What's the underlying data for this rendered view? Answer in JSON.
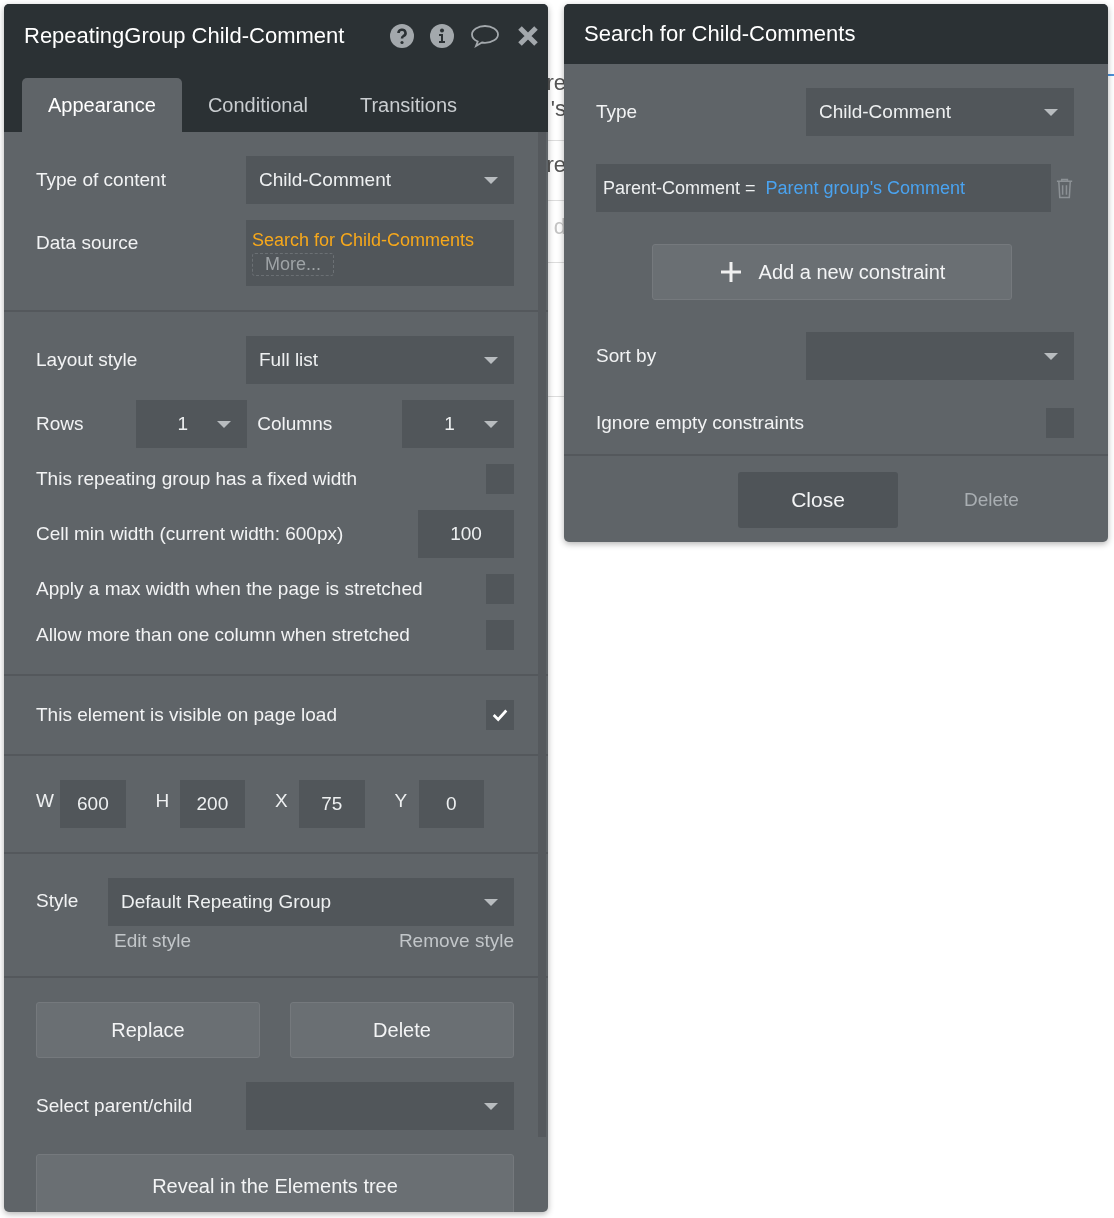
{
  "canvas_fragments": [
    "re",
    "'s",
    "re",
    "d"
  ],
  "properties_panel": {
    "title": "RepeatingGroup Child-Comment",
    "tabs": [
      {
        "label": "Appearance",
        "selected": true
      },
      {
        "label": "Conditional",
        "selected": false
      },
      {
        "label": "Transitions",
        "selected": false
      }
    ],
    "type_of_content": {
      "label": "Type of content",
      "value": "Child-Comment"
    },
    "data_source": {
      "label": "Data source",
      "value": "Search for Child-Comments",
      "more": "More..."
    },
    "layout_style": {
      "label": "Layout style",
      "value": "Full list"
    },
    "rows": {
      "label": "Rows",
      "value": "1"
    },
    "columns": {
      "label": "Columns",
      "value": "1"
    },
    "options": [
      {
        "kind": "checkbox",
        "label": "This repeating group has a fixed width",
        "checked": false
      },
      {
        "kind": "number",
        "label": "Cell min width (current width: 600px)",
        "value": "100"
      },
      {
        "kind": "checkbox",
        "label": "Apply a max width when the page is stretched",
        "checked": false
      },
      {
        "kind": "checkbox",
        "label": "Allow more than one column when stretched",
        "checked": false
      }
    ],
    "visible_on_load": {
      "label": "This element is visible on page load",
      "checked": true
    },
    "geometry": [
      {
        "label": "W",
        "value": "600"
      },
      {
        "label": "H",
        "value": "200"
      },
      {
        "label": "X",
        "value": "75"
      },
      {
        "label": "Y",
        "value": "0"
      }
    ],
    "style": {
      "label": "Style",
      "value": "Default Repeating Group",
      "edit": "Edit style",
      "remove": "Remove style"
    },
    "buttons": [
      "Replace",
      "Delete"
    ],
    "select_parent_child": {
      "label": "Select parent/child"
    },
    "reveal_button": "Reveal in the Elements tree"
  },
  "search_panel": {
    "title": "Search for Child-Comments",
    "type": {
      "label": "Type",
      "value": "Child-Comment"
    },
    "constraints": [
      {
        "field": "Parent-Comment =",
        "value": "Parent group's Comment"
      }
    ],
    "add_button": "Add a new constraint",
    "sort_by": {
      "label": "Sort by"
    },
    "ignore_empty": {
      "label": "Ignore empty constraints",
      "checked": false
    },
    "close_button": "Close",
    "delete_button": {
      "label": "Delete",
      "disabled": true
    }
  }
}
